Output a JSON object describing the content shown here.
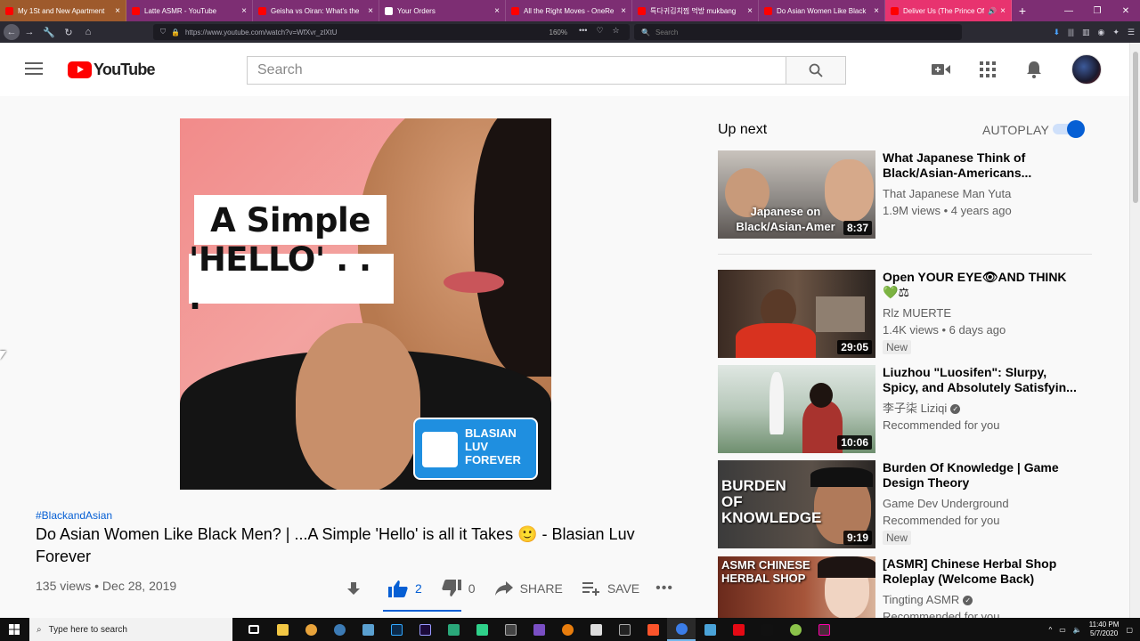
{
  "browser": {
    "tabs": [
      {
        "label": "My 1St and New Apartment",
        "icon": "youtube-icon"
      },
      {
        "label": "Latte ASMR - YouTube",
        "icon": "youtube-icon"
      },
      {
        "label": "Geisha vs Oiran: What's the",
        "icon": "youtube-icon"
      },
      {
        "label": "Your Orders",
        "icon": "amazon-icon"
      },
      {
        "label": "All the Right Moves - OneRe",
        "icon": "youtube-icon"
      },
      {
        "label": "특다귀김치찜 먹방 mukbang",
        "icon": "youtube-icon"
      },
      {
        "label": "Do Asian Women Like Black",
        "icon": "youtube-icon"
      },
      {
        "label": "Deliver Us (The Prince Of",
        "icon": "youtube-icon"
      }
    ],
    "url": "https://www.youtube.com/watch?v=WfXvr_zlXtU",
    "zoom": "160%",
    "search_placeholder": "Search"
  },
  "youtube": {
    "logo_text": "YouTube",
    "search_placeholder": "Search",
    "video": {
      "hashtag": "#BlackandAsian",
      "title": "Do Asian Women Like Black Men? | ...A Simple 'Hello' is all it Takes 🙂 - Blasian Luv Forever",
      "views_date": "135 views • Dec 28, 2019",
      "likes": "2",
      "dislikes": "0",
      "share_label": "SHARE",
      "save_label": "SAVE",
      "thumbnail_caption_1": "A Simple",
      "thumbnail_caption_2": "'HELLO' . . .",
      "brand_text": "BLASIAN LUV FOREVER"
    },
    "upnext": {
      "label": "Up next",
      "autoplay_label": "AUTOPLAY",
      "autoplay_on": true,
      "items": [
        {
          "title": "What Japanese Think of Black/Asian-Americans...",
          "channel": "That Japanese Man Yuta",
          "meta": "1.9M views • 4 years ago",
          "duration": "8:37",
          "badge": "",
          "verified": false,
          "thumb_text": "Japanese on Black/Asian-Amer"
        },
        {
          "title": "Open YOUR EYE👁AND THINK 💚⚖",
          "channel": "Rlz MUERTE",
          "meta": "1.4K views • 6 days ago",
          "duration": "29:05",
          "badge": "New",
          "verified": false,
          "thumb_text": ""
        },
        {
          "title": "Liuzhou \"Luosifen\": Slurpy, Spicy, and Absolutely Satisfyin...",
          "channel": "李子柒 Liziqi",
          "meta": "Recommended for you",
          "duration": "10:06",
          "badge": "",
          "verified": true,
          "thumb_text": ""
        },
        {
          "title": "Burden Of Knowledge | Game Design Theory",
          "channel": "Game Dev Underground",
          "meta": "Recommended for you",
          "duration": "9:19",
          "badge": "New",
          "verified": false,
          "thumb_text": "BURDEN OF KNOWLEDGE"
        },
        {
          "title": "[ASMR] Chinese Herbal Shop Roleplay (Welcome Back)",
          "channel": "Tingting ASMR",
          "meta": "Recommended for you",
          "duration": "",
          "badge": "",
          "verified": true,
          "thumb_text": "ASMR CHINESE HERBAL SHOP"
        }
      ]
    }
  },
  "taskbar": {
    "search_placeholder": "Type here to search",
    "time": "11:40 PM",
    "date": "5/7/2020"
  },
  "colors": {
    "tab_bar": "#7d2e73",
    "active_tab": "#e8336f",
    "youtube_red": "#ff0000",
    "link_blue": "#065fd4"
  }
}
